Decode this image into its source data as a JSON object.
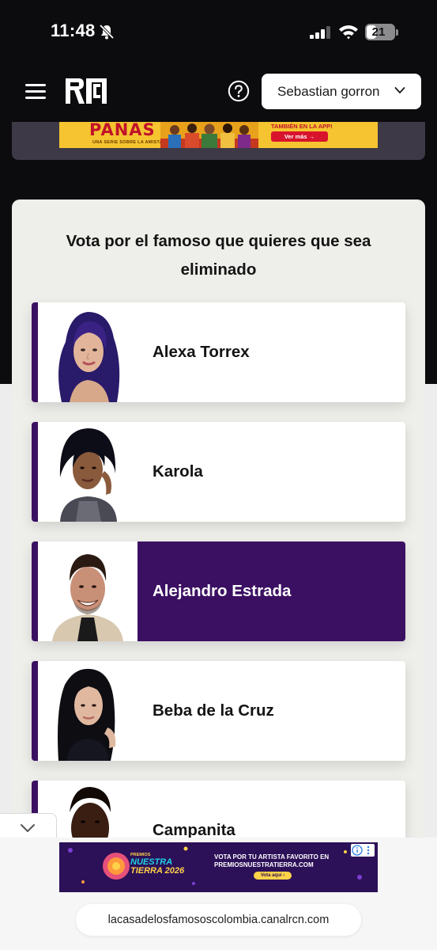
{
  "status_bar": {
    "time": "11:48",
    "battery": "21",
    "icons": [
      "bell-muted-icon",
      "signal-icon",
      "wifi-icon",
      "battery-icon"
    ]
  },
  "header": {
    "icons": [
      "menu-icon",
      "rcn-logo",
      "help-icon",
      "chevron-down-icon"
    ],
    "user_name": "Sebastian gorron"
  },
  "top_banner": {
    "brand": "PANAS",
    "tagline": "UNA SERIE SOBRE LA AMISTAD",
    "app_text": "TAMBIÉN EN LA APP!",
    "cta": "Ver más →"
  },
  "vote": {
    "title": "Vota por el famoso que quieres que sea eliminado",
    "accent_color": "#3b1062",
    "selected_index": 2,
    "options": [
      {
        "name": "Alexa Torrex"
      },
      {
        "name": "Karola"
      },
      {
        "name": "Alejandro Estrada"
      },
      {
        "name": "Beba de la Cruz"
      },
      {
        "name": "Campanita"
      }
    ]
  },
  "bottom_ad": {
    "small": "PREMIOS",
    "line1": "NUESTRA",
    "line2": "TIERRA 2026",
    "vote_text": "VOTA POR TU ARTISTA FAVORITO EN",
    "url_text": "PREMIOSNUESTRATIERRA.COM",
    "button": "Vota aquí ›"
  },
  "browser": {
    "url": "lacasadelosfamososcolombia.canalrcn.com"
  }
}
